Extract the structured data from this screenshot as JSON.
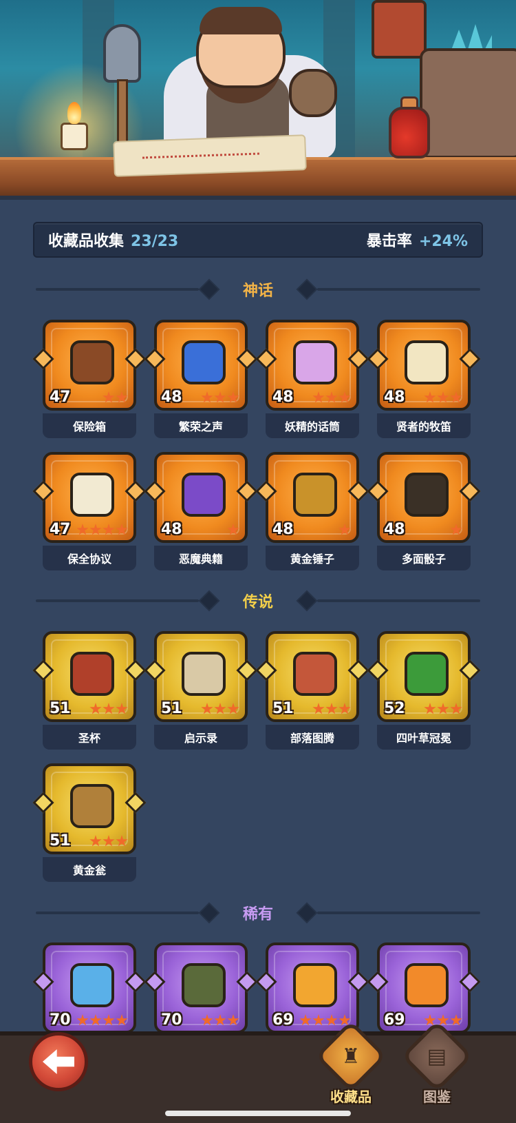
{
  "header": {
    "collection_label": "收藏品收集",
    "collection_count": "23/23",
    "crit_label": "暴击率",
    "crit_value": "+24%"
  },
  "sections": {
    "myth": {
      "title": "神话"
    },
    "legend": {
      "title": "传说"
    },
    "rare": {
      "title": "稀有"
    }
  },
  "myth_items": [
    {
      "name": "保险箱",
      "level": "47",
      "stars": 2,
      "icon": "treasure-chest-icon",
      "color": "#8a4a26"
    },
    {
      "name": "繁荣之声",
      "level": "48",
      "stars": 3,
      "icon": "spirit-orb-icon",
      "color": "#3a6fd8"
    },
    {
      "name": "妖精的话筒",
      "level": "48",
      "stars": 3,
      "icon": "fairy-microphone-icon",
      "color": "#d9a6e8"
    },
    {
      "name": "贤者的牧笛",
      "level": "48",
      "stars": 3,
      "icon": "sage-flute-icon",
      "color": "#f2e6c2"
    },
    {
      "name": "保全协议",
      "level": "47",
      "stars": 4,
      "icon": "contract-scroll-icon",
      "color": "#f2ead2"
    },
    {
      "name": "恶魔典籍",
      "level": "48",
      "stars": 1,
      "icon": "demon-tome-icon",
      "color": "#7b4bc8"
    },
    {
      "name": "黄金锤子",
      "level": "48",
      "stars": 1,
      "icon": "golden-hammer-icon",
      "color": "#c9922a"
    },
    {
      "name": "多面骰子",
      "level": "48",
      "stars": 1,
      "icon": "polyhedral-dice-icon",
      "color": "#3a3026"
    }
  ],
  "legend_items": [
    {
      "name": "圣杯",
      "level": "51",
      "stars": 3,
      "icon": "holy-grail-icon",
      "color": "#b0402a"
    },
    {
      "name": "启示录",
      "level": "51",
      "stars": 3,
      "icon": "revelation-book-icon",
      "color": "#d9c9a6"
    },
    {
      "name": "部落图腾",
      "level": "51",
      "stars": 3,
      "icon": "tribal-totem-icon",
      "color": "#c4573a"
    },
    {
      "name": "四叶草冠冕",
      "level": "52",
      "stars": 3,
      "icon": "clover-crown-icon",
      "color": "#3c9b3a"
    },
    {
      "name": "黄金瓮",
      "level": "51",
      "stars": 3,
      "icon": "golden-urn-icon",
      "color": "#b0803a"
    }
  ],
  "rare_items": [
    {
      "level": "70",
      "stars": 4,
      "icon": "ice-dagger-icon",
      "color": "#5ab0e8"
    },
    {
      "level": "70",
      "stars": 3,
      "icon": "thorn-ring-icon",
      "color": "#5a6a3a"
    },
    {
      "level": "69",
      "stars": 4,
      "icon": "lightning-rune-icon",
      "color": "#f2a630"
    },
    {
      "level": "69",
      "stars": 3,
      "icon": "phoenix-feather-icon",
      "color": "#f28a2a"
    }
  ],
  "nav": {
    "collection_label": "收藏品",
    "codex_label": "图鉴"
  },
  "colors": {
    "myth_accent": "#f2b347",
    "legend_accent": "#f2cf4a",
    "rare_accent": "#c79bf2",
    "stat_value": "#7ec4e6"
  }
}
